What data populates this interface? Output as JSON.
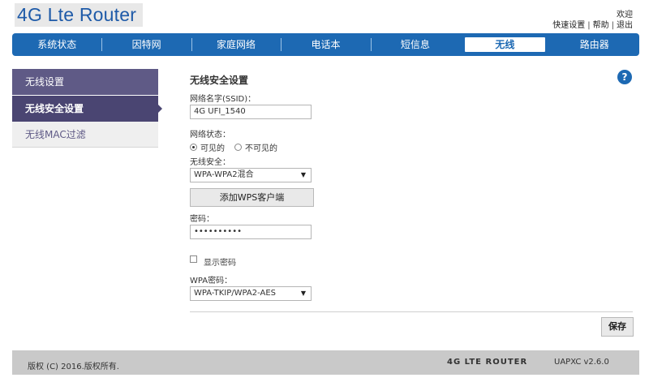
{
  "header": {
    "logo": "4G Lte Router",
    "welcome": "欢迎",
    "links": [
      "快速设置",
      "帮助",
      "退出"
    ],
    "link_separator": "|"
  },
  "nav": {
    "items": [
      "系统状态",
      "因特网",
      "家庭网络",
      "电话本",
      "短信息",
      "无线",
      "路由器"
    ],
    "active": "无线"
  },
  "sidebar": {
    "items": [
      "无线设置",
      "无线安全设置",
      "无线MAC过滤"
    ],
    "active": "无线安全设置"
  },
  "help_icon": "question-icon",
  "form": {
    "title": "无线安全设置",
    "ssid_label": "网络名字(SSID)：",
    "ssid_value": "4G UFI_1540",
    "status_label": "网络状态：",
    "status_options": [
      "可见的",
      "不可见的"
    ],
    "status_selected": "可见的",
    "security_label": "无线安全：",
    "security_value": "WPA-WPA2混合",
    "wps_button": "添加WPS客户端",
    "password_label": "密码：",
    "password_value": "••••••••••",
    "show_password_label": "显示密码",
    "show_password_checked": false,
    "wpa_cipher_label": "WPA密码：",
    "wpa_cipher_value": "WPA-TKIP/WPA2-AES",
    "save_button": "保存"
  },
  "footer": {
    "copyright": "版权 (C) 2016.版权所有.",
    "brand": "4G LTE ROUTER",
    "version": "UAPXC v2.6.0"
  },
  "colors": {
    "nav_blue": "#1d69b3",
    "sidebar_dark": "#5f5a86",
    "sidebar_active": "#4a4572",
    "footer_gray": "#c9c9c9"
  }
}
